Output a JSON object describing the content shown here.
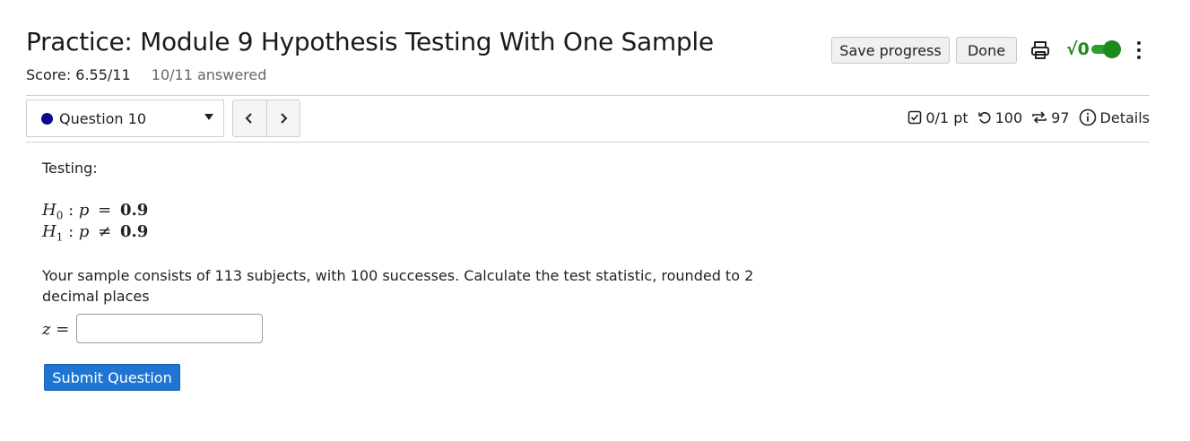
{
  "header": {
    "title": "Practice: Module 9 Hypothesis Testing With One Sample",
    "score": "Score: 6.55/11",
    "answered": "10/11 answered",
    "save_label": "Save progress",
    "done_label": "Done",
    "icons": {
      "print": "print-icon",
      "math": "sqrt-toggle-icon",
      "menu": "kebab-menu-icon"
    }
  },
  "question_bar": {
    "selected_question": "Question 10",
    "meta": {
      "points": "0/1 pt",
      "retries": "100",
      "attempts": "97",
      "details": "Details"
    }
  },
  "question": {
    "intro": "Testing:",
    "h0": {
      "sub": "0",
      "rel": "=",
      "value": "0.9"
    },
    "h1": {
      "sub": "1",
      "rel": "≠",
      "value": "0.9"
    },
    "prompt_line1": "Your sample consists of 113 subjects, with 100 successes. Calculate the test statistic, rounded to 2",
    "prompt_line2": "decimal places",
    "answer_value": "",
    "submit_label": "Submit Question"
  },
  "colors": {
    "accent_blue": "#1f76d2",
    "toggle_green": "#1c8a1c",
    "question_dot": "#0a0a8c"
  }
}
